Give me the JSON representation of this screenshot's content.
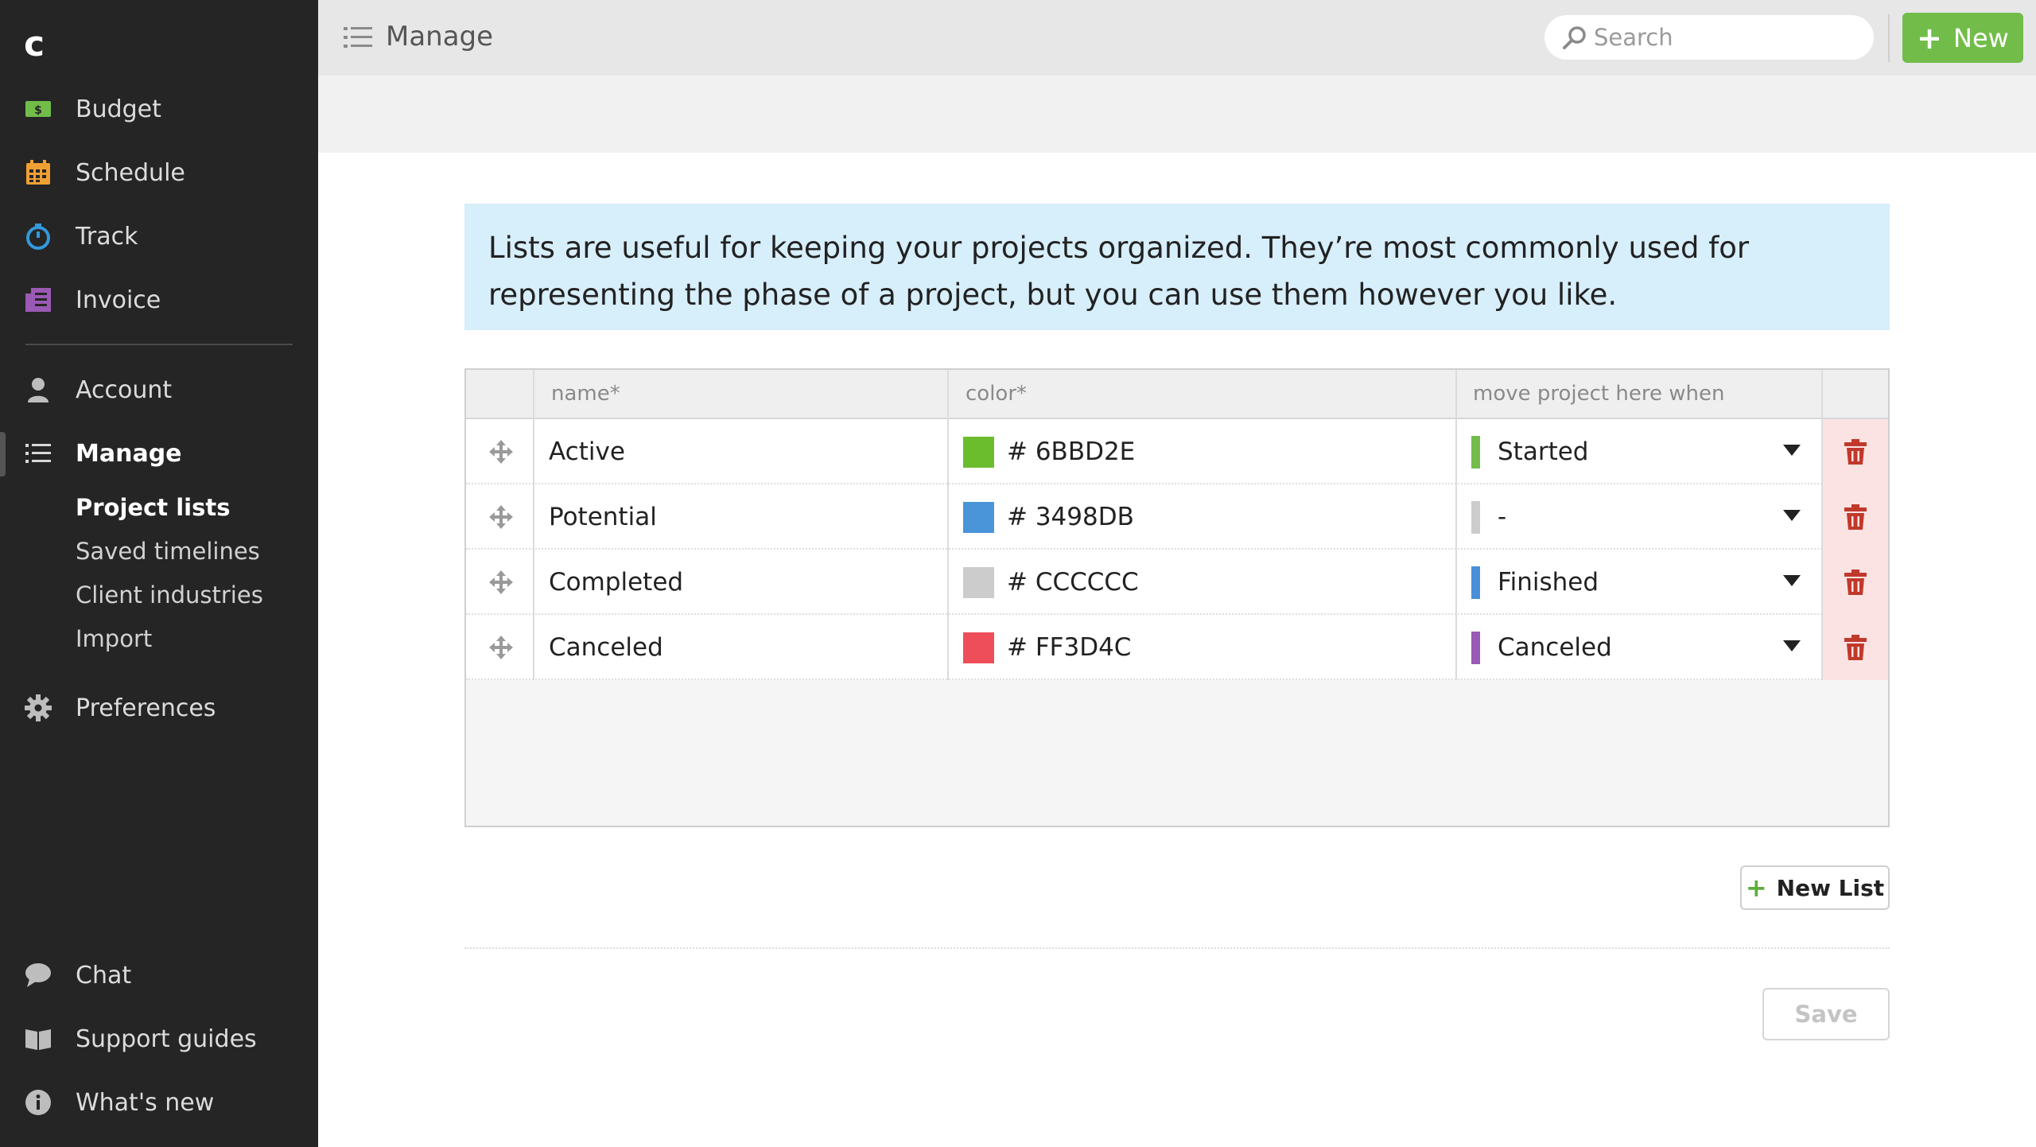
{
  "app": {
    "logo": "c"
  },
  "sidebar": {
    "items": [
      {
        "label": "Budget",
        "icon": "money-icon",
        "color": "#72bd4a"
      },
      {
        "label": "Schedule",
        "icon": "calendar-icon",
        "color": "#f0a033"
      },
      {
        "label": "Track",
        "icon": "stopwatch-icon",
        "color": "#3498db"
      },
      {
        "label": "Invoice",
        "icon": "invoice-icon",
        "color": "#9b59b6"
      },
      {
        "label": "Account",
        "icon": "user-icon"
      },
      {
        "label": "Manage",
        "icon": "list-icon",
        "active": true
      },
      {
        "label": "Preferences",
        "icon": "gear-icon"
      }
    ],
    "subitems": [
      {
        "label": "Project lists",
        "active": true
      },
      {
        "label": "Saved timelines"
      },
      {
        "label": "Client industries"
      },
      {
        "label": "Import"
      }
    ],
    "bottom": [
      {
        "label": "Chat",
        "icon": "chat-icon"
      },
      {
        "label": "Support guides",
        "icon": "book-icon"
      },
      {
        "label": "What's new",
        "icon": "info-icon"
      }
    ]
  },
  "header": {
    "title": "Manage",
    "search_placeholder": "Search",
    "new_label": "New",
    "accent": "#72bd4a"
  },
  "info_text": "Lists are useful for keeping your projects organized. They’re most commonly used for representing the phase of a project, but you can use them however you like.",
  "table": {
    "headers": {
      "name": "name*",
      "color": "color*",
      "move": "move project here when"
    },
    "rows": [
      {
        "name": "Active",
        "hex": "# 6BBD2E",
        "color": "#6BBD2E",
        "when": "Started",
        "when_color": "#72bd4a"
      },
      {
        "name": "Potential",
        "hex": "# 3498DB",
        "color": "#3498DB",
        "when": "-",
        "when_color": "#cccccc"
      },
      {
        "name": "Completed",
        "hex": "# CCCCCC",
        "color": "#CCCCCC",
        "when": "Finished",
        "when_color": "#4a90d9"
      },
      {
        "name": "Canceled",
        "hex": "# FF3D4C",
        "color": "#EE4D5A",
        "when": "Canceled",
        "when_color": "#9b59b6"
      }
    ]
  },
  "actions": {
    "new_list": "New List",
    "save": "Save"
  }
}
